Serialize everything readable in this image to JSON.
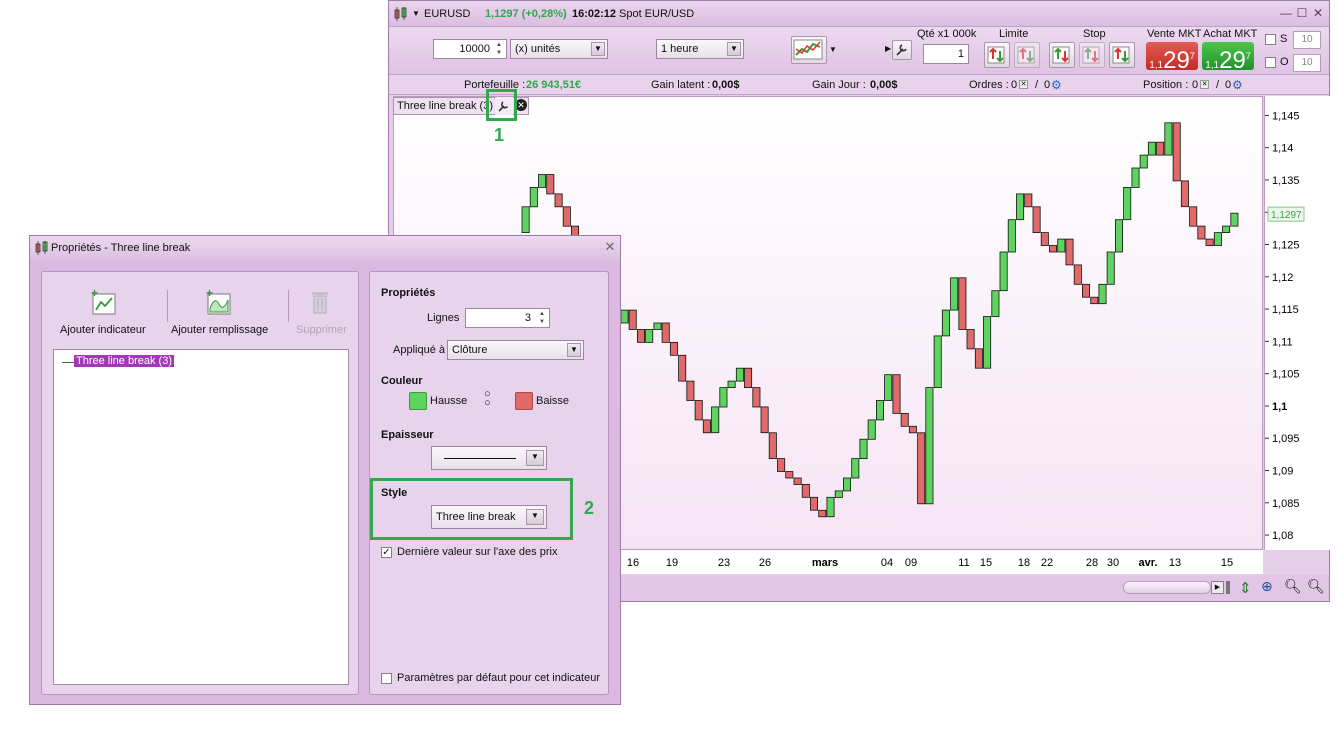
{
  "main_window": {
    "symbol": "EURUSD",
    "price_change": "1,1297 (+0,28%)",
    "time": "16:02:12",
    "instrument": "Spot EUR/USD",
    "controls": {
      "minimize": "—",
      "maximize": "☐",
      "close": "✕"
    }
  },
  "toolbar": {
    "quantity": "10000",
    "unit_select": "(x) unités",
    "timeframe": "1 heure",
    "qty_label": "Qté x1 000k",
    "qty_value": "1",
    "limit_label": "Limite",
    "stop_label": "Stop",
    "sell_label": "Vente MKT",
    "buy_label": "Achat MKT",
    "sell_small": "1,1",
    "sell_big": "29",
    "sell_sup": "7",
    "buy_small": "1,1",
    "buy_big": "29",
    "buy_sup": "7",
    "s_label": "S",
    "o_label": "O",
    "s_value": "10",
    "o_value": "10"
  },
  "info_bar": {
    "portfolio_label": "Portefeuille :",
    "portfolio_value": "26 943,51€",
    "latent_label": "Gain latent :",
    "latent_value": "0,00$",
    "day_label": "Gain Jour :",
    "day_value": "0,00$",
    "orders_label": "Ordres :",
    "orders_a": "0",
    "orders_b": "0",
    "position_label": "Position :",
    "position_a": "0",
    "position_b": "0"
  },
  "chart": {
    "tab_label": "Three line break (3)",
    "current_price_label": "1,1297",
    "accent_up": "#5fd35f",
    "accent_down": "#e06a6a"
  },
  "chart_data": {
    "type": "line",
    "title": "",
    "xlabel": "",
    "ylabel": "",
    "ylim": [
      1.078,
      1.148
    ],
    "y_ticks": [
      "1,145",
      "1,14",
      "1,135",
      "1,13",
      "1,125",
      "1,12",
      "1,115",
      "1,11",
      "1,105",
      "1,1",
      "1,095",
      "1,09",
      "1,085",
      "1,08"
    ],
    "x_ticks": [
      "16",
      "19",
      "23",
      "26",
      "mars",
      "04",
      "09",
      "11",
      "15",
      "18",
      "22",
      "28",
      "30",
      "avr.",
      "13",
      "15"
    ],
    "series": [
      {
        "values": [
          1.127,
          1.131,
          1.134,
          1.136,
          1.133,
          1.131,
          1.128,
          1.124,
          1.121,
          1.118,
          1.116,
          1.114,
          1.113,
          1.115,
          1.112,
          1.11,
          1.112,
          1.113,
          1.11,
          1.108,
          1.104,
          1.101,
          1.098,
          1.096,
          1.1,
          1.103,
          1.104,
          1.106,
          1.103,
          1.1,
          1.096,
          1.092,
          1.09,
          1.089,
          1.088,
          1.086,
          1.084,
          1.083,
          1.086,
          1.087,
          1.089,
          1.092,
          1.095,
          1.098,
          1.101,
          1.105,
          1.099,
          1.097,
          1.096,
          1.085,
          1.103,
          1.111,
          1.115,
          1.12,
          1.112,
          1.109,
          1.106,
          1.114,
          1.118,
          1.124,
          1.129,
          1.133,
          1.131,
          1.127,
          1.125,
          1.124,
          1.126,
          1.122,
          1.119,
          1.117,
          1.116,
          1.119,
          1.124,
          1.129,
          1.134,
          1.137,
          1.139,
          1.141,
          1.139,
          1.144,
          1.135,
          1.131,
          1.128,
          1.126,
          1.125,
          1.127,
          1.128,
          1.13
        ]
      }
    ]
  },
  "dialog": {
    "title": "Propriétés - Three line break",
    "add_indicator": "Ajouter indicateur",
    "add_fill": "Ajouter remplissage",
    "delete": "Supprimer",
    "tree_item": "Three line break (3)",
    "props_title": "Propriétés",
    "lines_label": "Lignes",
    "lines_value": "3",
    "applied_label": "Appliqué à",
    "applied_value": "Clôture",
    "color_title": "Couleur",
    "up_label": "Hausse",
    "down_label": "Baisse",
    "thickness_title": "Epaisseur",
    "style_title": "Style",
    "style_value": "Three line break",
    "last_value_label": "Dernière valeur sur l'axe des prix",
    "default_params_label": "Paramètres par défaut pour cet indicateur"
  },
  "annotations": {
    "one": "1",
    "two": "2"
  }
}
